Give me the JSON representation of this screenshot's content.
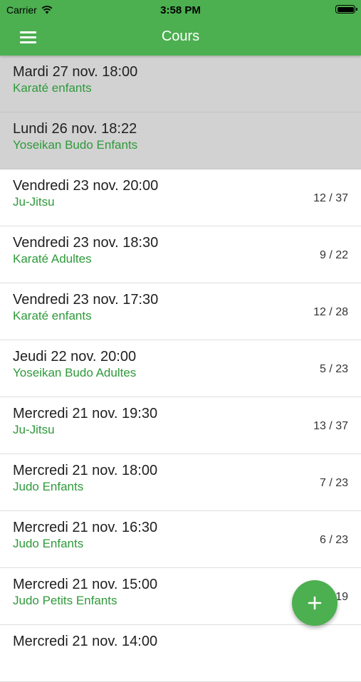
{
  "status_bar": {
    "carrier": "Carrier",
    "time": "3:58 PM",
    "wifi_icon": "wifi-icon",
    "battery_icon": "battery-icon",
    "battery_level": 1.0
  },
  "app_bar": {
    "title": "Cours",
    "menu_icon": "hamburger-menu-icon"
  },
  "colors": {
    "primary": "#4caf50",
    "course_text": "#2e9a3a",
    "past_row_background": "#d2d2d2"
  },
  "sessions": [
    {
      "date": "Mardi 27 nov. 18:00",
      "course": "Karaté enfants",
      "count": "",
      "past": true
    },
    {
      "date": "Lundi 26 nov. 18:22",
      "course": "Yoseikan Budo Enfants",
      "count": "",
      "past": true
    },
    {
      "date": "Vendredi 23 nov. 20:00",
      "course": "Ju-Jitsu",
      "count": "12 / 37",
      "past": false
    },
    {
      "date": "Vendredi 23 nov. 18:30",
      "course": "Karaté Adultes",
      "count": "9 / 22",
      "past": false
    },
    {
      "date": "Vendredi 23 nov. 17:30",
      "course": "Karaté enfants",
      "count": "12 / 28",
      "past": false
    },
    {
      "date": "Jeudi 22 nov. 20:00",
      "course": "Yoseikan Budo Adultes",
      "count": "5 / 23",
      "past": false
    },
    {
      "date": "Mercredi 21 nov. 19:30",
      "course": "Ju-Jitsu",
      "count": "13 / 37",
      "past": false
    },
    {
      "date": "Mercredi 21 nov. 18:00",
      "course": "Judo Enfants",
      "count": "7 / 23",
      "past": false
    },
    {
      "date": "Mercredi 21 nov. 16:30",
      "course": "Judo Enfants",
      "count": "6 / 23",
      "past": false
    },
    {
      "date": "Mercredi 21 nov. 15:00",
      "course": "Judo Petits Enfants",
      "count": "19",
      "past": false
    },
    {
      "date": "Mercredi 21 nov. 14:00",
      "course": "",
      "count": "",
      "past": false
    }
  ],
  "fab": {
    "icon": "plus-icon",
    "label": "+"
  }
}
